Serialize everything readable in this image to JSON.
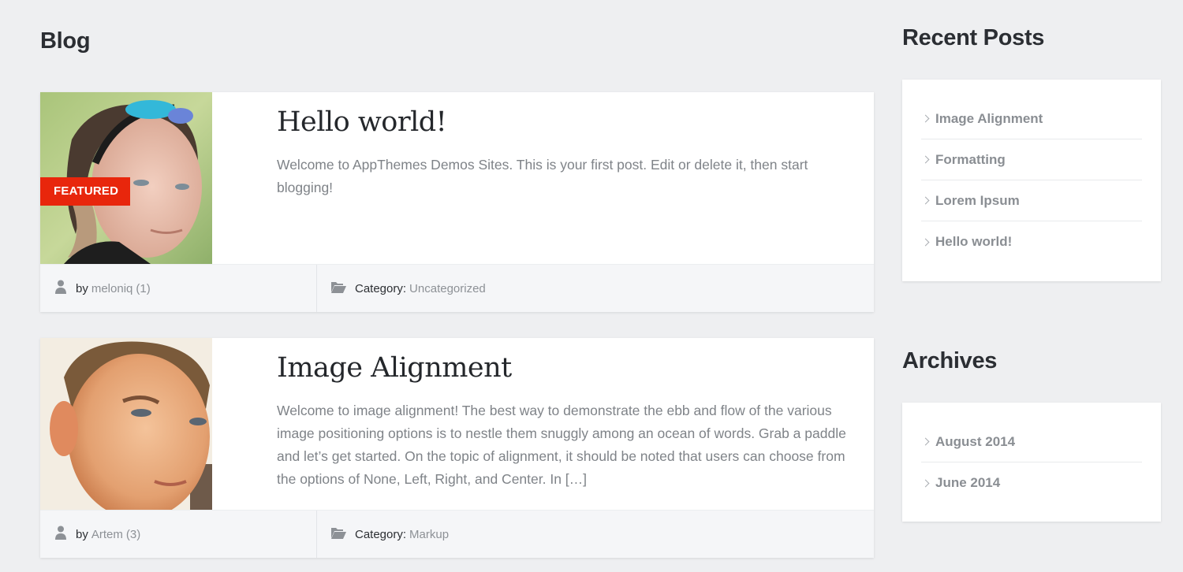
{
  "page": {
    "title": "Blog"
  },
  "posts": [
    {
      "title": "Hello world!",
      "excerpt": "Welcome to AppThemes Demos Sites. This is your first post. Edit or delete it, then start blogging!",
      "badge": "FEATURED",
      "thumbnail_icon": "post-thumbnail-image",
      "author_prefix": "by",
      "author": "meloniq",
      "author_count": "(1)",
      "category_label": "Category:",
      "category": "Uncategorized"
    },
    {
      "title": "Image Alignment",
      "excerpt": "Welcome to image alignment! The best way to demonstrate the ebb and flow of the various image positioning options is to nestle them snuggly among an ocean of words. Grab a paddle and let’s get started. On the topic of alignment, it should be noted that users can choose from the options of None, Left, Right, and Center. In […]",
      "thumbnail_icon": "post-thumbnail-image",
      "author_prefix": "by",
      "author": "Artem",
      "author_count": "(3)",
      "category_label": "Category:",
      "category": "Markup"
    }
  ],
  "sidebar": {
    "recent_posts": {
      "title": "Recent Posts",
      "items": [
        "Image Alignment",
        "Formatting",
        "Lorem Ipsum",
        "Hello world!"
      ]
    },
    "archives": {
      "title": "Archives",
      "items": [
        "August 2014",
        "June 2014"
      ]
    }
  },
  "colors": {
    "background": "#eeeff1",
    "featured_badge": "#e8260c",
    "muted_link": "#8d9196"
  },
  "icons": {
    "author": "user-icon",
    "category": "folder-open-icon",
    "list_bullet": "chevron-right-icon"
  }
}
